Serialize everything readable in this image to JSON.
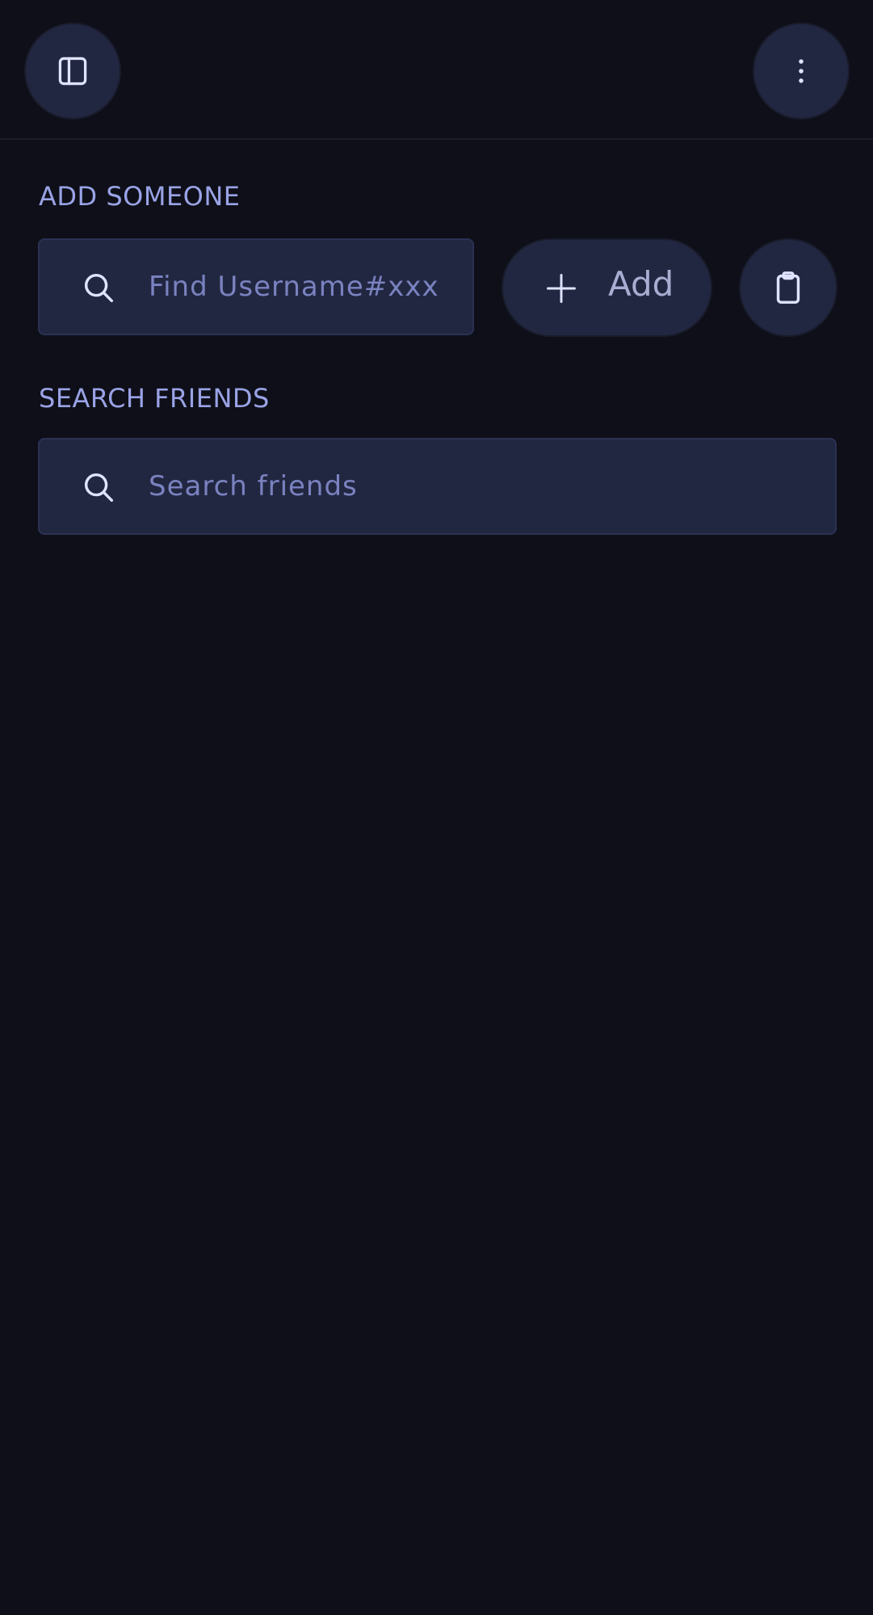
{
  "header": {
    "sidebar_toggle_icon": "sidebar-icon",
    "more_icon": "more-vertical-icon"
  },
  "add_someone": {
    "label": "ADD SOMEONE",
    "input_placeholder": "Find Username#xxx",
    "input_value": "",
    "add_button_label": "Add",
    "add_icon": "plus-icon",
    "clipboard_icon": "clipboard-icon"
  },
  "search_friends": {
    "label": "SEARCH FRIENDS",
    "input_placeholder": "Search friends",
    "input_value": ""
  },
  "colors": {
    "background": "#0e0f18",
    "surface": "#222741",
    "label": "#9aa3e6",
    "placeholder": "#7a82c0"
  }
}
